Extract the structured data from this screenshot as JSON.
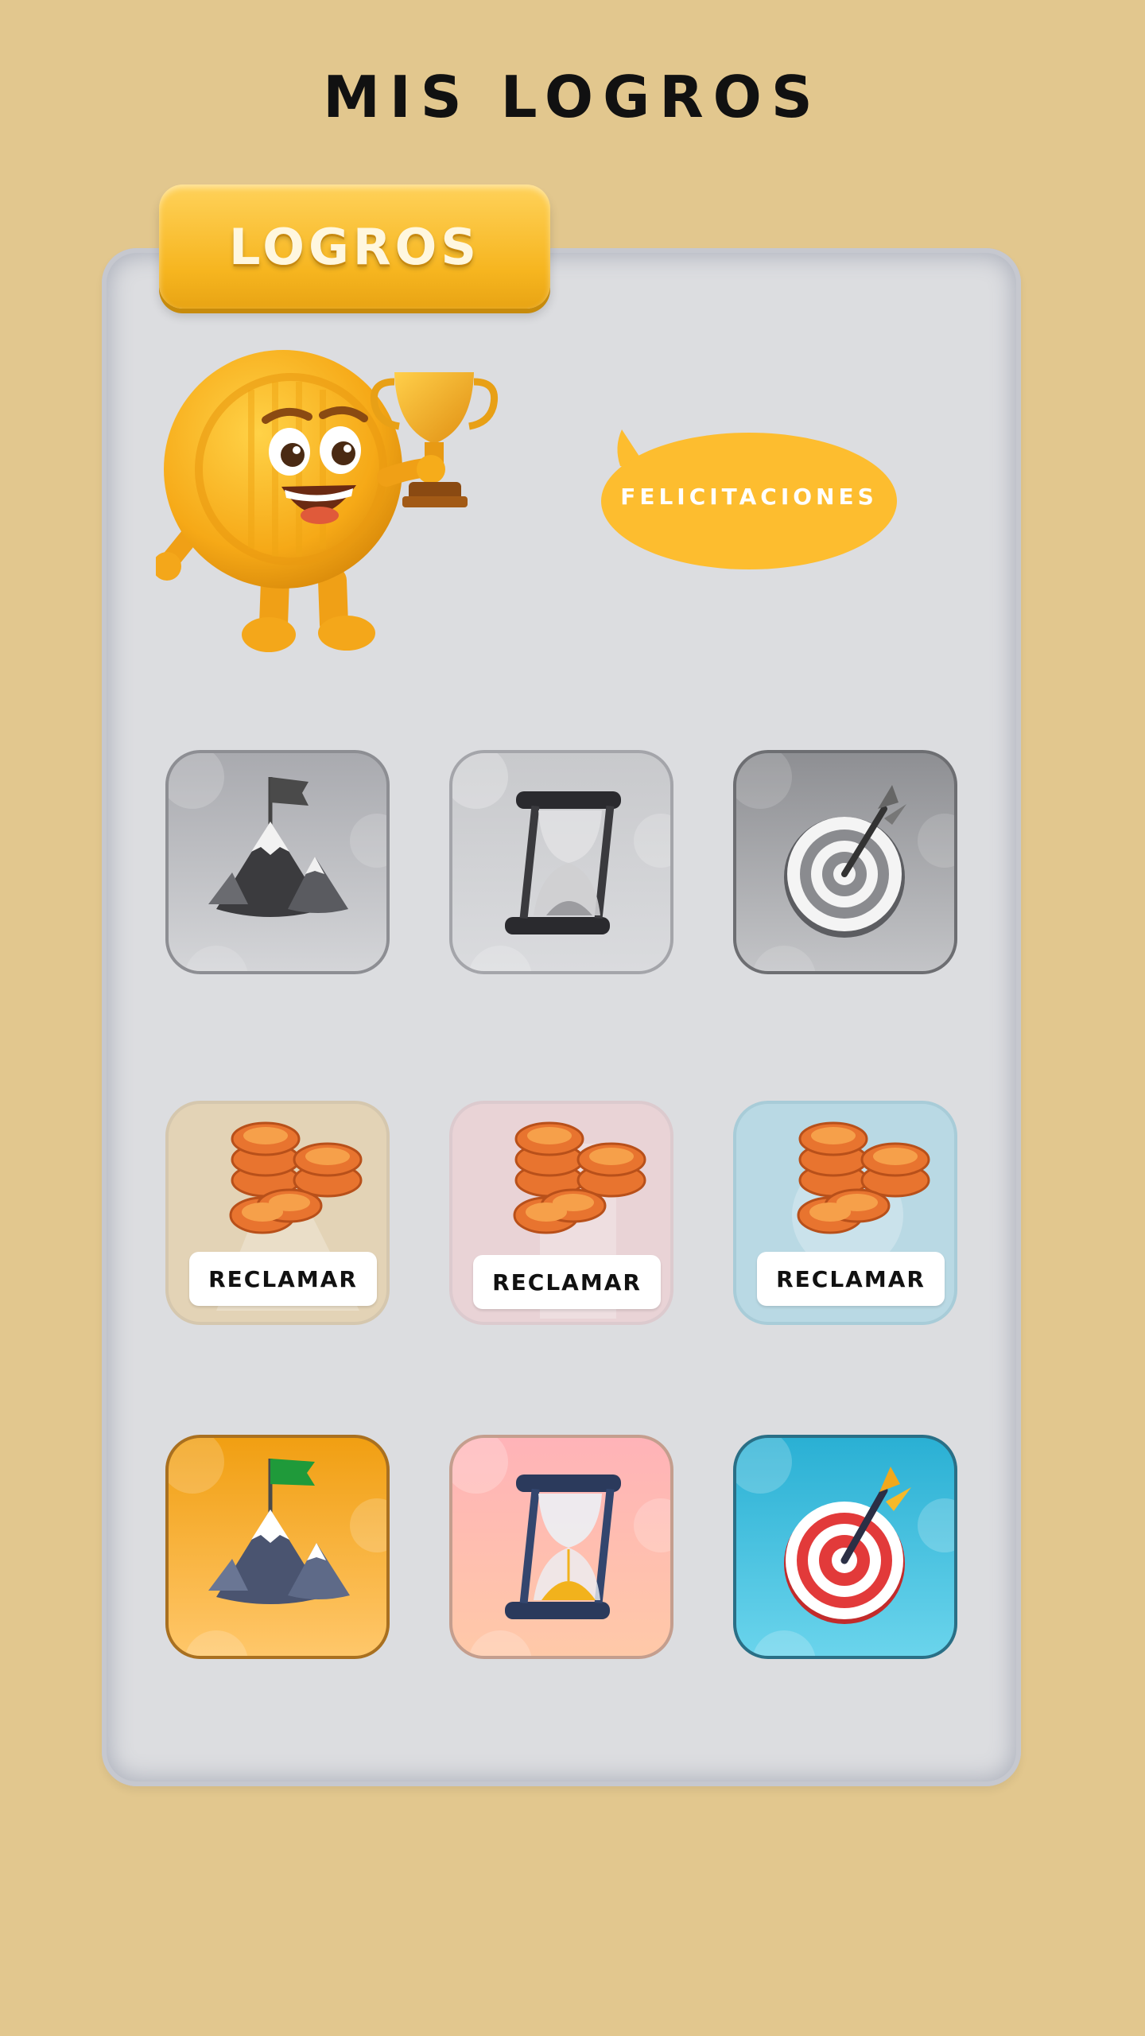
{
  "header": {
    "title": "MIS LOGROS"
  },
  "panel": {
    "tab_label": "LOGROS",
    "congrats_text": "FELICITACIONES"
  },
  "achievements": {
    "locked": [
      {
        "icon": "mountain-flag-icon",
        "state": "locked"
      },
      {
        "icon": "hourglass-icon",
        "state": "locked"
      },
      {
        "icon": "target-dart-icon",
        "state": "locked"
      }
    ],
    "claimable": [
      {
        "icon": "coin-stack-icon",
        "claim_label": "RECLAMAR",
        "tint": "#e3d3b6"
      },
      {
        "icon": "coin-stack-icon",
        "claim_label": "RECLAMAR",
        "tint": "#e9d3d6"
      },
      {
        "icon": "coin-stack-icon",
        "claim_label": "RECLAMAR",
        "tint": "#b9d9e4"
      }
    ],
    "unlocked": [
      {
        "icon": "mountain-flag-icon",
        "state": "unlocked",
        "color": "#f3a51d"
      },
      {
        "icon": "hourglass-icon",
        "state": "unlocked",
        "color": "#ffb1b1"
      },
      {
        "icon": "target-dart-icon",
        "state": "unlocked",
        "color": "#3bb3d8"
      }
    ]
  },
  "colors": {
    "background": "#e2c78e",
    "accent": "#f8bb2a",
    "panel": "#dcdde0"
  }
}
